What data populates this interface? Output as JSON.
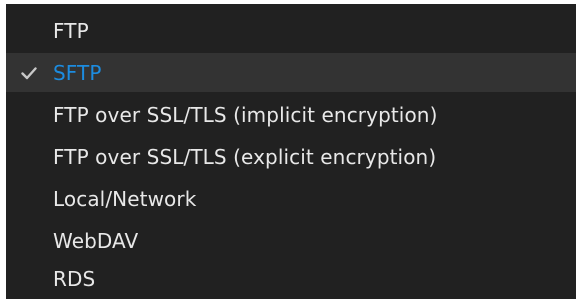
{
  "menu": {
    "accent_color": "#1c8ce0",
    "background_color": "#212121",
    "selected_index": 1,
    "items": [
      {
        "label": "FTP"
      },
      {
        "label": "SFTP",
        "checked": true
      },
      {
        "label": "FTP over SSL/TLS (implicit encryption)"
      },
      {
        "label": "FTP over SSL/TLS (explicit encryption)"
      },
      {
        "label": "Local/Network"
      },
      {
        "label": "WebDAV"
      },
      {
        "label": "RDS"
      }
    ]
  }
}
